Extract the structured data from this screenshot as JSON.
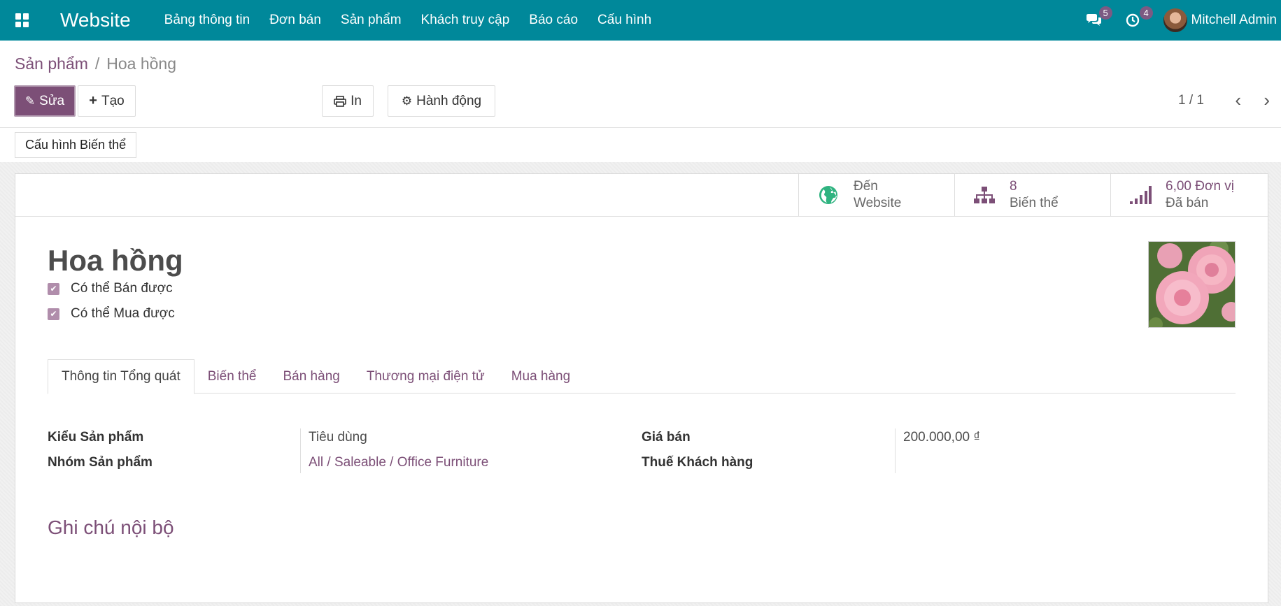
{
  "navbar": {
    "brand": "Website",
    "menu": [
      "Bảng thông tin",
      "Đơn bán",
      "Sản phẩm",
      "Khách truy cập",
      "Báo cáo",
      "Cấu hình"
    ],
    "messages_count": "5",
    "activities_count": "4",
    "user_name": "Mitchell Admin",
    "icons": {
      "apps": "apps-grid-icon",
      "messages": "chat-bubbles-icon",
      "activities": "clock-icon"
    }
  },
  "breadcrumb": {
    "parent": "Sản phẩm",
    "separator": "/",
    "current": "Hoa hồng"
  },
  "toolbar": {
    "edit_label": "Sửa",
    "create_label": "Tạo",
    "print_label": "In",
    "action_label": "Hành động",
    "pager": "1 / 1",
    "prev": "‹",
    "next": "›"
  },
  "statusbar": {
    "configure_variants": "Cấu hình Biến thể"
  },
  "smart_buttons": [
    {
      "value": "Đến",
      "label": "Website",
      "icon": "globe-icon"
    },
    {
      "value": "8",
      "label": "Biến thể",
      "icon": "sitemap-icon"
    },
    {
      "value": "6,00 Đơn vị",
      "label": "Đã bán",
      "icon": "signal-bars-icon"
    }
  ],
  "product": {
    "name": "Hoa hồng",
    "can_be_sold": "Có thể Bán được",
    "can_be_purchased": "Có thể Mua được"
  },
  "tabs": [
    "Thông tin Tổng quát",
    "Biến thể",
    "Bán hàng",
    "Thương mại điện tử",
    "Mua hàng"
  ],
  "fields": {
    "product_type_label": "Kiểu Sản phẩm",
    "product_type_value": "Tiêu dùng",
    "category_label": "Nhóm Sản phẩm",
    "category_value": "All / Saleable / Office Furniture",
    "sales_price_label": "Giá bán",
    "sales_price_value": "200.000,00 ₫",
    "customer_tax_label": "Thuế Khách hàng",
    "customer_tax_value": ""
  },
  "notes": {
    "title": "Ghi chú nội bộ"
  },
  "colors": {
    "navbar": "#00889a",
    "primary": "#7c4f77",
    "globe": "#2fb380"
  }
}
